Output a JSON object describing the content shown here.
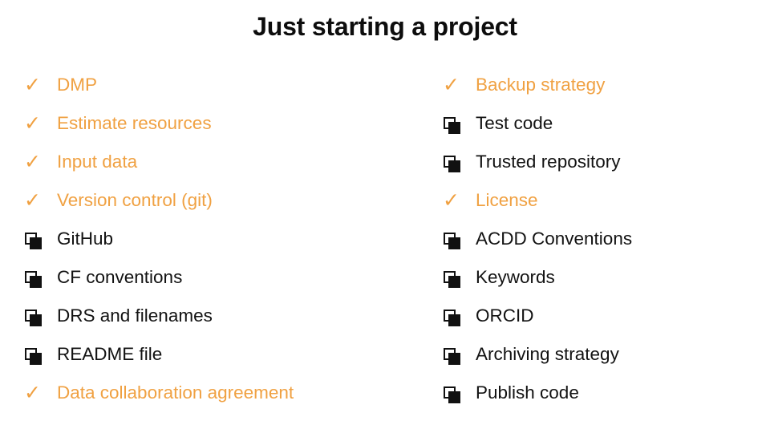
{
  "slide": {
    "title": "Just starting a project",
    "colors": {
      "accent_orange": "#F0A142",
      "text_black": "#121212",
      "title_black": "#0D0D0D",
      "background": "#FFFFFF"
    },
    "markers": {
      "done_icon": "check-icon",
      "done_glyph": "✓",
      "todo_icon": "empty-checkbox-icon",
      "todo_glyph": "❏"
    },
    "columns": [
      {
        "name": "left-column",
        "items": [
          {
            "label": "DMP",
            "state": "done"
          },
          {
            "label": "Estimate resources",
            "state": "done"
          },
          {
            "label": "Input data",
            "state": "done"
          },
          {
            "label": "Version control (git)",
            "state": "done"
          },
          {
            "label": "GitHub",
            "state": "todo"
          },
          {
            "label": "CF conventions",
            "state": "todo"
          },
          {
            "label": "DRS and filenames",
            "state": "todo"
          },
          {
            "label": "README file",
            "state": "todo"
          },
          {
            "label": "Data collaboration agreement",
            "state": "done"
          }
        ]
      },
      {
        "name": "right-column",
        "items": [
          {
            "label": "Backup strategy",
            "state": "done"
          },
          {
            "label": "Test code",
            "state": "todo"
          },
          {
            "label": "Trusted repository",
            "state": "todo"
          },
          {
            "label": "License",
            "state": "done"
          },
          {
            "label": "ACDD Conventions",
            "state": "todo"
          },
          {
            "label": "Keywords",
            "state": "todo"
          },
          {
            "label": "ORCID",
            "state": "todo"
          },
          {
            "label": "Archiving strategy",
            "state": "todo"
          },
          {
            "label": "Publish code",
            "state": "todo"
          }
        ]
      }
    ]
  }
}
